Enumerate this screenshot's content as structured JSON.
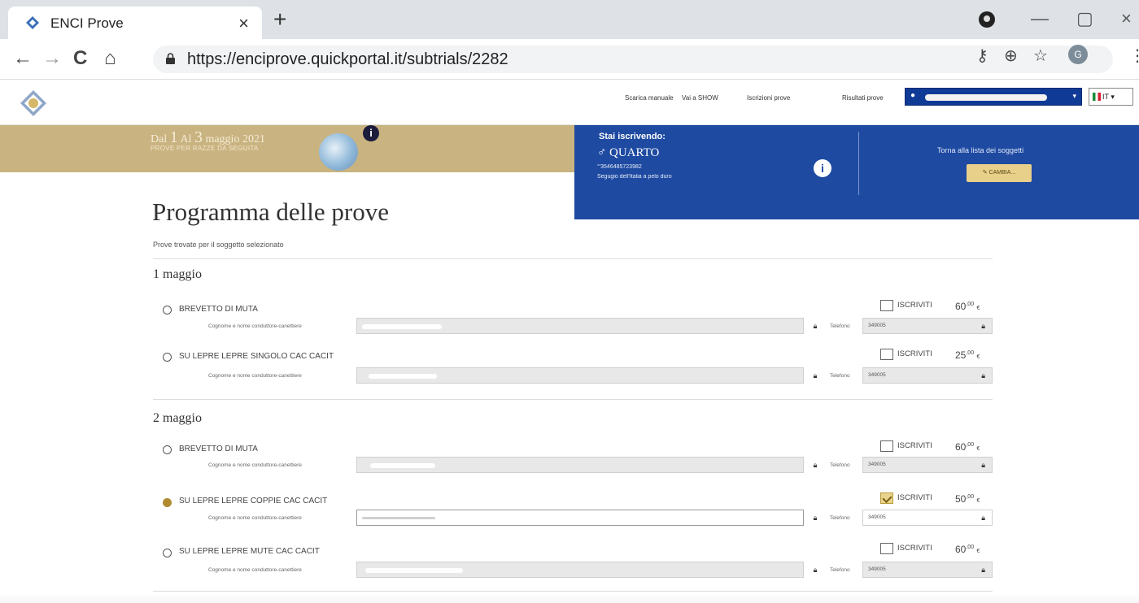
{
  "browser": {
    "tab_title": "ENCI Prove",
    "tab_close": "×",
    "new_tab": "+",
    "url": "https://enciprove.quickportal.it/subtrials/2282",
    "nav": {
      "back": "←",
      "forward": "→",
      "reload": "C",
      "home": "⌂"
    },
    "window": {
      "minimize": "—",
      "maximize": "▢",
      "close": "×"
    },
    "profile_initial": "G"
  },
  "header": {
    "links": [
      "Scarica manuale",
      "Vai a SHOW",
      "Iscrizioni prove",
      "Risultati prove"
    ],
    "language": "IT"
  },
  "event": {
    "dates_prefix": "Dal",
    "date_from": "1",
    "date_joiner": "Al",
    "date_to": "3",
    "dates_suffix": "maggio 2021",
    "type": "PROVE PER RAZZE DA SEGUITA"
  },
  "enrollment": {
    "heading": "Stai iscrivendo:",
    "dog_name": "♂ QUARTO",
    "chip": "°'3546485723982",
    "breed": "Segugio dell'Italia a pelo duro",
    "back_link": "Torna alla lista dei soggetti",
    "change_button": "✎ CAMBIA..."
  },
  "main": {
    "title": "Programma delle prove",
    "subtitle": "Prove trovate per il soggetto selezionato",
    "handler_label": "Cognome e nome conduttore-canettiere",
    "phone_label": "Telefono",
    "enroll_label": "ISCRIVITI",
    "currency": "€",
    "days": [
      {
        "title": "1 maggio",
        "trials": [
          {
            "name": "BREVETTO DI MUTA",
            "phone": "349005",
            "price_int": "60",
            "price_dec": ",00",
            "selected": false
          },
          {
            "name": "SU LEPRE LEPRE SINGOLO CAC CACIT",
            "phone": "349005",
            "price_int": "25",
            "price_dec": ",00",
            "selected": false
          }
        ]
      },
      {
        "title": "2 maggio",
        "trials": [
          {
            "name": "BREVETTO DI MUTA",
            "phone": "349005",
            "price_int": "60",
            "price_dec": ",00",
            "selected": false
          },
          {
            "name": "SU LEPRE LEPRE COPPIE CAC CACIT",
            "phone": "349005",
            "price_int": "50",
            "price_dec": ",00",
            "selected": true
          },
          {
            "name": "SU LEPRE LEPRE MUTE CAC CACIT",
            "phone": "349005",
            "price_int": "60",
            "price_dec": ",00",
            "selected": false
          }
        ]
      }
    ]
  },
  "colors": {
    "banner_gold": "#c9b380",
    "panel_blue": "#1e4aa2",
    "selected_gold": "#b08a2e"
  }
}
